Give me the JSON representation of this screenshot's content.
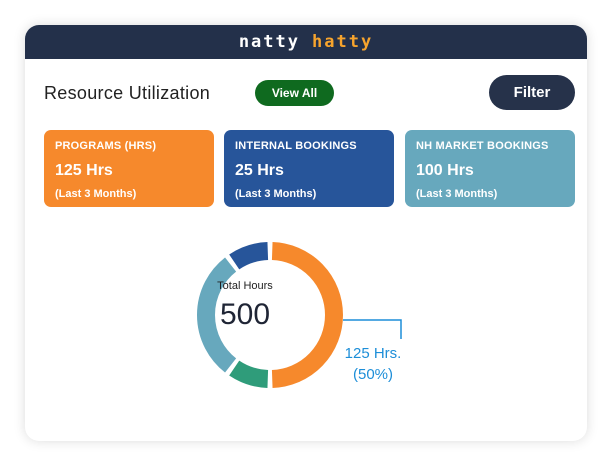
{
  "brand": {
    "part1": "natty",
    "part2": "hatty",
    "colors": {
      "text": "#ffffff",
      "accent": "#f7a42d",
      "bar": "#23304a"
    }
  },
  "header": {
    "title": "Resource Utilization",
    "view_all_label": "View All",
    "filter_label": "Filter"
  },
  "stats": [
    {
      "label": "PROGRAMS (HRS)",
      "value": "125 Hrs",
      "period": "(Last 3 Months)",
      "color": "#f6892c"
    },
    {
      "label": "INTERNAL BOOKINGS",
      "value": "25 Hrs",
      "period": "(Last 3 Months)",
      "color": "#27559a"
    },
    {
      "label": "NH MARKET BOOKINGS",
      "value": "100 Hrs",
      "period": "(Last 3 Months)",
      "color": "#67a8bd"
    }
  ],
  "donut": {
    "center_label": "Total Hours",
    "center_value": "500",
    "callout_line1": "125 Hrs.",
    "callout_line2": "(50%)",
    "segments": [
      {
        "name": "orange",
        "fraction": 0.5,
        "color": "#f6892c"
      },
      {
        "name": "green",
        "fraction": 0.1,
        "color": "#2f9c7a"
      },
      {
        "name": "teal",
        "fraction": 0.3,
        "color": "#67a8bd"
      },
      {
        "name": "blue",
        "fraction": 0.1,
        "color": "#27559a"
      }
    ]
  }
}
